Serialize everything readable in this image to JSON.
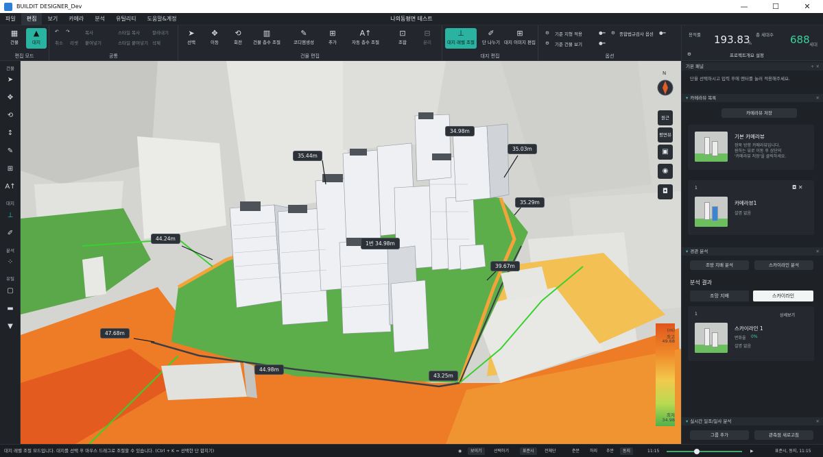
{
  "window": {
    "app_title": "BUILDIT DESIGNER_Dev",
    "controls": [
      "—",
      "☐",
      "✕"
    ]
  },
  "menu": {
    "items": [
      "파일",
      "편집",
      "보기",
      "카메라",
      "분석",
      "유틸리티",
      "도움말&계정"
    ],
    "active": "편집",
    "document_title": "나의동평면 테스트"
  },
  "ribbon": {
    "edit_mode": {
      "label": "편집 모드",
      "buttons": [
        "건물",
        "대지"
      ]
    },
    "common": {
      "label": "공통",
      "items": [
        "되돌리기",
        "다시",
        "복사",
        "붙여넣기",
        "잘라내기",
        "스타일 복사",
        "스타일 붙여넣기",
        "삭제"
      ],
      "short": [
        "취소",
        "리셋"
      ]
    },
    "building_edit": {
      "label": "건물 편집",
      "buttons": [
        "선택",
        "이동",
        "회전",
        "건물 층수 조절",
        "코디엠생성",
        "추가",
        "자동 층수 조절",
        "조합",
        "분리"
      ]
    },
    "site_edit": {
      "label": "대지 편집",
      "buttons": [
        "대지 레벨 조절",
        "단 나누기",
        "대지 이미지 편집"
      ]
    },
    "options": {
      "label": "옵션",
      "items": [
        "기준 지형 적용",
        "기준 건물 보기",
        "종합법규검사 옵션"
      ]
    }
  },
  "stats": {
    "far_label": "용적률",
    "far_value": "193.83",
    "far_unit": "%",
    "households_label": "총 세대수",
    "households_value": "688",
    "households_unit": "세대",
    "project_settings": "프로젝트개요 설정"
  },
  "left_toolbar": {
    "sections": [
      "건물",
      "대지",
      "분석",
      "유틸"
    ]
  },
  "viewport": {
    "height_labels": [
      "35.44m",
      "34.98m",
      "35.03m",
      "35.29m",
      "44.24m",
      "1번 34.98m",
      "39.67m",
      "47.68m",
      "44.98m",
      "43.25m"
    ],
    "compass": "N",
    "view_buttons": [
      "원근",
      "평면뷰"
    ],
    "legend": {
      "unit": "(m)",
      "max_label": "최고",
      "max_value": "49.68",
      "min_label": "최저",
      "min_value": "34.98"
    }
  },
  "right_panel": {
    "basic_panel": {
      "title": "기본 패널",
      "hint": "단을 선택하시고 입력 후에 엔터를 눌러 적용해주세요."
    },
    "camera_list": {
      "title": "카메라뷰 목록",
      "save_button": "카메라뷰 저장",
      "cards": [
        {
          "title": "기본 카메라뷰",
          "desc": [
            "정북 방향 카메라뷰입니다.",
            "원하는 뷰로 이동 후 상단의",
            "'카메라뷰 저장'을 클릭하세요."
          ]
        },
        {
          "index": "1",
          "title": "카메라뷰1",
          "desc": [
            "설명 없음"
          ]
        }
      ]
    },
    "view_analysis": {
      "title": "경관 분석",
      "buttons": [
        "조망 지배 분석",
        "스카이라인 분석"
      ],
      "result_title": "분석 결과",
      "tabs": [
        "조망 지배",
        "스카이라인"
      ],
      "active_tab": "스카이라인",
      "card": {
        "index": "1",
        "detail": "상세보기",
        "title": "스카이라인 1",
        "ratio_label": "변화율",
        "ratio_value": "0%",
        "desc": "설명 없음"
      }
    },
    "sunlight": {
      "title": "실시간 일조/일사 분석",
      "buttons": [
        "그룹 추가",
        "관측점 새로고침"
      ]
    }
  },
  "statusbar": {
    "message": "대지 레벨 조절 모드입니다. 대지를 선택 후 마우스 드래그로 조절할 수 있습니다. (Ctrl + K = 선택한 단 합치기)",
    "chips": [
      "보이기",
      "선택하기",
      "표준시",
      "전체단",
      "춘분",
      "하지",
      "추분",
      "동지"
    ],
    "time": "11:15",
    "time_full": "표준시, 동지, 11:15"
  },
  "colors": {
    "accent": "#2bb3a1",
    "far_green": "#3ad29a",
    "ground_green": "#5cae4a",
    "terrain_orange": "#ee7b25"
  }
}
